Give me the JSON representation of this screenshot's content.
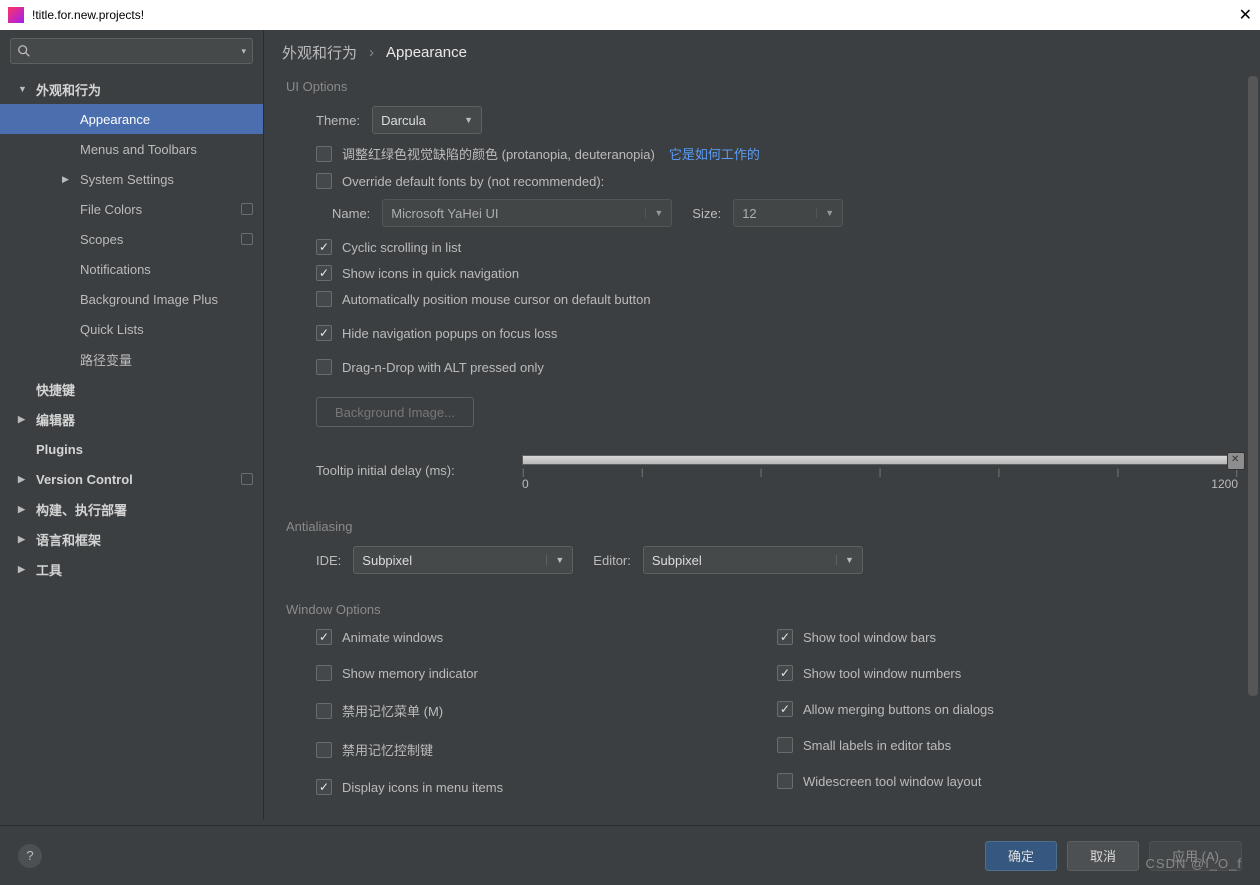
{
  "window": {
    "title": "!title.for.new.projects!"
  },
  "sidebar": {
    "search_placeholder": "",
    "items": [
      {
        "label": "外观和行为",
        "bold": true,
        "expandable": true,
        "expanded": true
      },
      {
        "label": "Appearance",
        "child": true,
        "selected": true
      },
      {
        "label": "Menus and Toolbars",
        "child": true
      },
      {
        "label": "System Settings",
        "child": true,
        "expandable": true
      },
      {
        "label": "File Colors",
        "child": true,
        "tail": true
      },
      {
        "label": "Scopes",
        "child": true,
        "tail": true
      },
      {
        "label": "Notifications",
        "child": true
      },
      {
        "label": "Background Image Plus",
        "child": true
      },
      {
        "label": "Quick Lists",
        "child": true
      },
      {
        "label": "路径变量",
        "child": true
      },
      {
        "label": "快捷键",
        "bold": true
      },
      {
        "label": "编辑器",
        "bold": true,
        "expandable": true
      },
      {
        "label": "Plugins",
        "bold": true
      },
      {
        "label": "Version Control",
        "bold": true,
        "expandable": true,
        "tail": true
      },
      {
        "label": "构建、执行部署",
        "bold": true,
        "expandable": true
      },
      {
        "label": "语言和框架",
        "bold": true,
        "expandable": true
      },
      {
        "label": "工具",
        "bold": true,
        "expandable": true
      }
    ]
  },
  "breadcrumb": {
    "root": "外观和行为",
    "current": "Appearance"
  },
  "ui_options": {
    "title": "UI Options",
    "theme_label": "Theme:",
    "theme_value": "Darcula",
    "colorblind_label": "调整红绿色视觉缺陷的颜色 (protanopia, deuteranopia)",
    "colorblind_link": "它是如何工作的",
    "override_fonts_label": "Override default fonts by (not recommended):",
    "font_name_label": "Name:",
    "font_name_value": "Microsoft YaHei UI",
    "font_size_label": "Size:",
    "font_size_value": "12",
    "cyclic_label": "Cyclic scrolling in list",
    "quick_nav_label": "Show icons in quick navigation",
    "auto_cursor_label": "Automatically position mouse cursor on default button",
    "hide_popups_label": "Hide navigation popups on focus loss",
    "dnd_alt_label": "Drag-n-Drop with ALT pressed only",
    "bg_image_btn": "Background Image...",
    "tooltip_label": "Tooltip initial delay (ms):",
    "tooltip_min": "0",
    "tooltip_max": "1200"
  },
  "antialiasing": {
    "title": "Antialiasing",
    "ide_label": "IDE:",
    "ide_value": "Subpixel",
    "editor_label": "Editor:",
    "editor_value": "Subpixel"
  },
  "window_options": {
    "title": "Window Options",
    "animate": "Animate windows",
    "memory": "Show memory indicator",
    "disable_mnemonics_menu": "禁用记忆菜单 (M)",
    "disable_mnemonics_ctrl": "禁用记忆控制键",
    "display_icons": "Display icons in menu items",
    "tool_bars": "Show tool window bars",
    "tool_numbers": "Show tool window numbers",
    "merge_dialogs": "Allow merging buttons on dialogs",
    "small_labels": "Small labels in editor tabs",
    "widescreen": "Widescreen tool window layout"
  },
  "footer": {
    "ok": "确定",
    "cancel": "取消",
    "apply": "应用 (A)"
  },
  "watermark": "CSDN @I_O_f"
}
